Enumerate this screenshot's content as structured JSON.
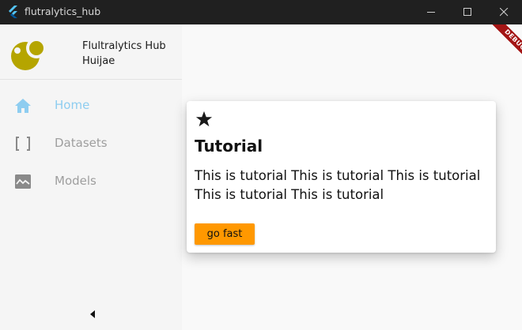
{
  "window": {
    "title": "flutralytics_hub",
    "controls": [
      "minimize-icon",
      "maximize-icon",
      "close-icon"
    ]
  },
  "sidebar": {
    "app_name": "Flultralytics Hub",
    "user_name": "Huijae",
    "items": [
      {
        "label": "Home",
        "icon": "home-icon",
        "active": true
      },
      {
        "label": "Datasets",
        "icon": "brackets-icon",
        "active": false
      },
      {
        "label": "Models",
        "icon": "image-icon",
        "active": false
      }
    ],
    "collapse_icon": "caret-left-icon"
  },
  "card": {
    "icon": "star-icon",
    "title": "Tutorial",
    "body": "This is tutorial This is tutorial This is tutorial This is tutorial This is tutorial",
    "button_label": "go fast"
  },
  "debug_banner": "DEBUG",
  "colors": {
    "titlebar": "#202020",
    "sidebar_bg": "#f5f5f5",
    "active_nav": "#8ecdf0",
    "inactive_nav": "#9e9e9e",
    "button": "#ff9800",
    "logo": "#b5a500",
    "debug": "#a31515"
  }
}
